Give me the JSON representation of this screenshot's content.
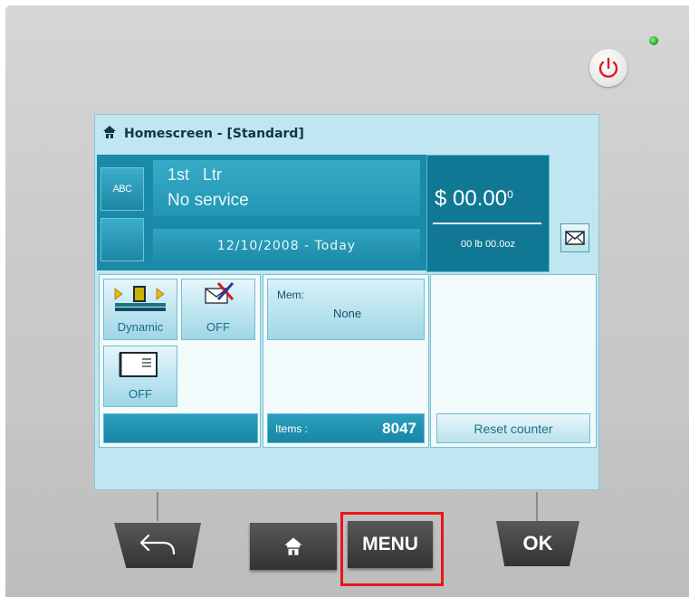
{
  "device": {
    "led_color": "#1c9a1c",
    "power_icon": "power-icon"
  },
  "screen": {
    "title": "Homescreen - [Standard]",
    "title_icon": "home-icon",
    "abc_label": "ABC",
    "service_line1": "1st   Ltr",
    "service_line2": "No service",
    "date_text": "12/10/2008 - Today",
    "amount": "$ 00.00",
    "amount_superscript": "0",
    "weight": "00 lb 00.0oz",
    "mail_icon": "envelope-icon",
    "tiles": {
      "dynamic_label": "Dynamic",
      "dynamic_icon": "dynamic-scale-icon",
      "envelope_off_label": "OFF",
      "envelope_off_icon": "envelope-crossed-icon",
      "feeder_off_label": "OFF",
      "feeder_icon": "label-feeder-icon"
    },
    "memory": {
      "label": "Mem:",
      "value": "None"
    },
    "items": {
      "label": "Items :",
      "count": "8047"
    },
    "reset_label": "Reset counter"
  },
  "hardware": {
    "back_icon": "back-arrow-icon",
    "home_icon": "home-icon",
    "menu_label": "MENU",
    "ok_label": "OK",
    "highlight_color": "#e8151a"
  },
  "colors": {
    "accent": "#1b8aa8",
    "screen_bg": "#bfe6f1"
  }
}
